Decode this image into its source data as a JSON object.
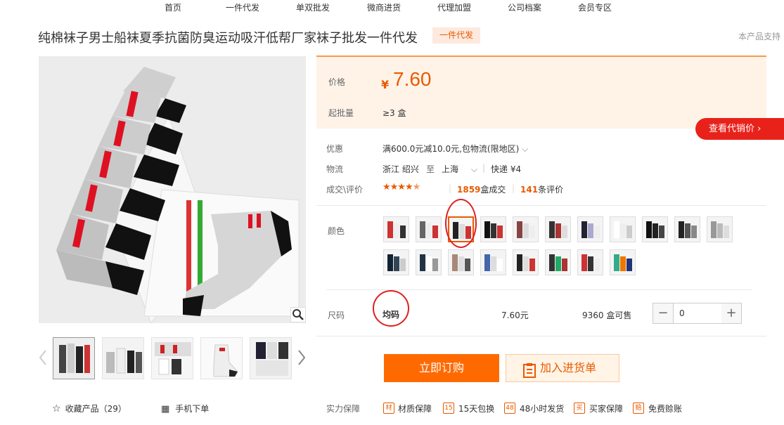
{
  "nav": [
    "首页",
    "一件代发",
    "单双批发",
    "微商进货",
    "代理加盟",
    "公司档案",
    "会员专区"
  ],
  "product": {
    "title": "纯棉袜子男士船袜夏季抗菌防臭运动吸汗低帮厂家袜子批发一件代发",
    "tag": "一件代发",
    "support_text": "本产品支持"
  },
  "price": {
    "label": "价格",
    "currency": "¥",
    "value": "7.60",
    "moq_label": "起批量",
    "moq_value": "≥3  盒",
    "daixiao_button": "查看代销价 ›"
  },
  "info": {
    "promo_label": "优惠",
    "promo_value": "满600.0元减10.0元,包物流(限地区)",
    "logistics_label": "物流",
    "from": "浙江 绍兴",
    "to_word": "至",
    "dest": "上海",
    "express": "快递 ¥4",
    "deal_label": "成交\\评价",
    "deal_count": "1859",
    "deal_unit": "盒成交",
    "review_count": "141",
    "review_unit": "条评价",
    "rating": 4.5
  },
  "color": {
    "label": "颜色",
    "selected_index": 2,
    "swatch_count": 19
  },
  "size": {
    "label": "尺码",
    "name": "均码",
    "price": "7.60元",
    "stock": "9360 盒可售",
    "quantity": "0"
  },
  "actions": {
    "order": "立即订购",
    "add_cart": "加入进货单"
  },
  "gallery": {
    "favorite": "收藏产品（29）",
    "mobile": "手机下单"
  },
  "guarantee": {
    "label": "实力保障",
    "items": [
      {
        "icon": "材",
        "text": "材质保障"
      },
      {
        "icon": "15",
        "text": "15天包换"
      },
      {
        "icon": "48",
        "text": "48小时发货"
      },
      {
        "icon": "买",
        "text": "买家保障"
      },
      {
        "icon": "赔",
        "text": "免费赊账"
      }
    ]
  },
  "colors": {
    "accent": "#e85a00",
    "cta": "#ff6a00",
    "red": "#e8221b"
  }
}
